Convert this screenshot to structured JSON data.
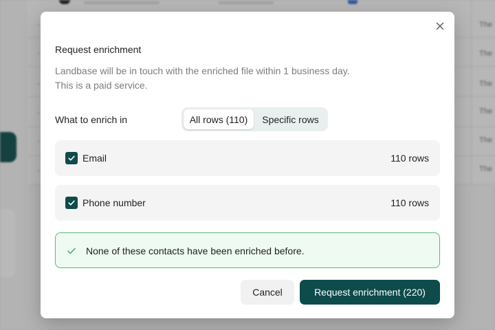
{
  "background": {
    "cell_text": "The",
    "cell_dash": "-"
  },
  "modal": {
    "close_icon": "close-icon",
    "title": "Request enrichment",
    "description_line1": "Landbase will be in touch with the enriched file within 1 business day.",
    "description_line2": "This is a paid service.",
    "enrich_in_label": "What to enrich in",
    "segment": {
      "options": [
        {
          "label": "All rows (110)",
          "selected": true
        },
        {
          "label": "Specific rows",
          "selected": false
        }
      ]
    },
    "fields": [
      {
        "label": "Email",
        "count": "110 rows",
        "checked": true
      },
      {
        "label": "Phone number",
        "count": "110 rows",
        "checked": true
      }
    ],
    "notice": {
      "icon": "check-icon",
      "text": "None of these contacts have been enriched before."
    },
    "actions": {
      "cancel_label": "Cancel",
      "submit_label": "Request enrichment (220)"
    }
  },
  "colors": {
    "primary": "#0e4b4b",
    "notice_border": "#5cb97c",
    "notice_bg": "#eefaf2",
    "segment_bg": "#e9efef"
  }
}
